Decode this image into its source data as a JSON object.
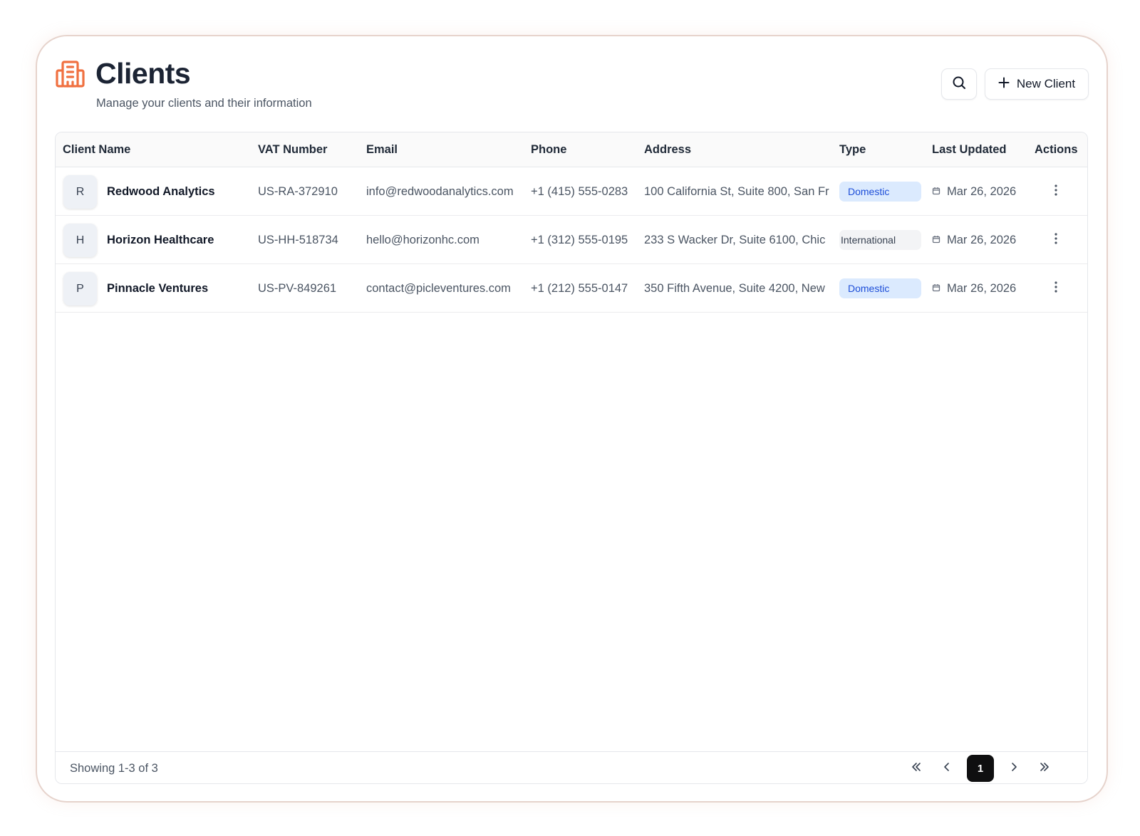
{
  "header": {
    "title": "Clients",
    "subtitle": "Manage your clients and their information",
    "icon": "building-icon",
    "accent_color": "#f07040"
  },
  "toolbar": {
    "search_icon": "search-icon",
    "new_client_label": "New Client",
    "new_client_icon": "plus-icon"
  },
  "table": {
    "columns": [
      "Client Name",
      "VAT Number",
      "Email",
      "Phone",
      "Address",
      "Type",
      "Last Updated",
      "Actions"
    ],
    "rows": [
      {
        "initial": "R",
        "name": "Redwood Analytics",
        "vat": "US-RA-372910",
        "email": "info@redwoodanalytics.com",
        "phone": "+1 (415) 555-0283",
        "address": "100 California St, Suite 800, San Fr",
        "type": "Domestic",
        "last_updated": "Mar 26, 2026"
      },
      {
        "initial": "H",
        "name": "Horizon Healthcare",
        "vat": "US-HH-518734",
        "email": "hello@horizonhc.com",
        "phone": "+1 (312) 555-0195",
        "address": "233 S Wacker Dr, Suite 6100, Chic",
        "type": "International",
        "last_updated": "Mar 26, 2026"
      },
      {
        "initial": "P",
        "name": "Pinnacle Ventures",
        "vat": "US-PV-849261",
        "email": "contact@picleventures.com",
        "phone": "+1 (212) 555-0147",
        "address": "350 Fifth Avenue, Suite 4200, New",
        "type": "Domestic",
        "last_updated": "Mar 26, 2026"
      }
    ]
  },
  "footer": {
    "showing": "Showing 1-3 of 3",
    "current_page": "1"
  }
}
